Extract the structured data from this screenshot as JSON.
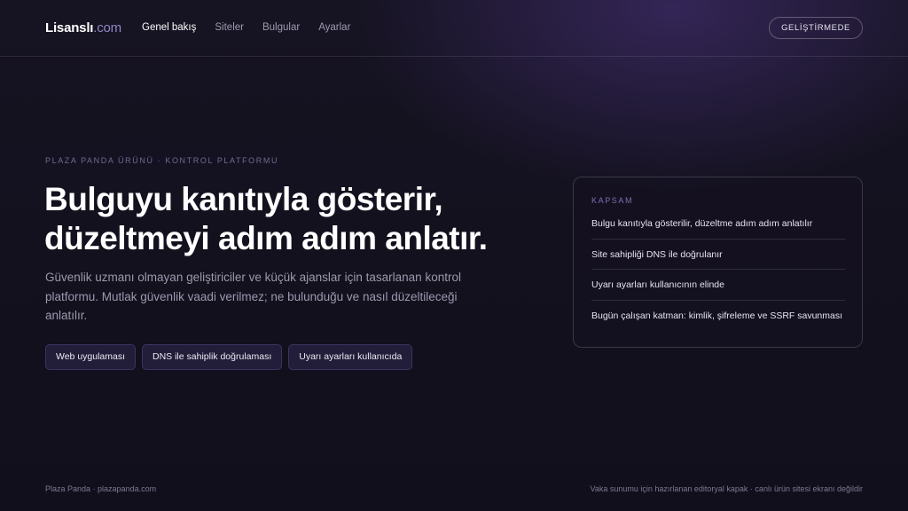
{
  "header": {
    "brand_name": "Lisanslı",
    "brand_suffix": ".com",
    "nav": [
      "Genel bakış",
      "Siteler",
      "Bulgular",
      "Ayarlar"
    ],
    "active_nav": "Genel bakış",
    "status_badge": "GELİŞTİRMEDE"
  },
  "hero": {
    "eyebrow": "PLAZA PANDA ÜRÜNÜ · KONTROL PLATFORMU",
    "headline_line1": "Bulguyu kanıtıyla gösterir,",
    "headline_line2": "düzeltmeyi adım adım anlatır.",
    "lead": "Güvenlik uzmanı olmayan geliştiriciler ve küçük ajanslar için tasarlanan kontrol platformu. Mutlak güvenlik vaadi verilmez; ne bulunduğu ve nasıl düzeltileceği anlatılır.",
    "tags": [
      "Web uygulaması",
      "DNS ile sahiplik doğrulaması",
      "Uyarı ayarları kullanıcıda"
    ]
  },
  "scope_card": {
    "title": "KAPSAM",
    "items": [
      "Bulgu kanıtıyla gösterilir, düzeltme adım adım anlatılır",
      "Site sahipliği DNS ile doğrulanır",
      "Uyarı ayarları kullanıcının elinde",
      "Bugün çalışan katman: kimlik, şifreleme ve SSRF savunması"
    ]
  },
  "footer": {
    "left": "Plaza Panda · plazapanda.com",
    "right": "Vaka sunumu için hazırlanan editoryal kapak · canlı ürün sitesi ekranı değildir"
  },
  "colors": {
    "background": "#13111e",
    "accent": "#8d86c4",
    "tag_background": "#221d38"
  }
}
